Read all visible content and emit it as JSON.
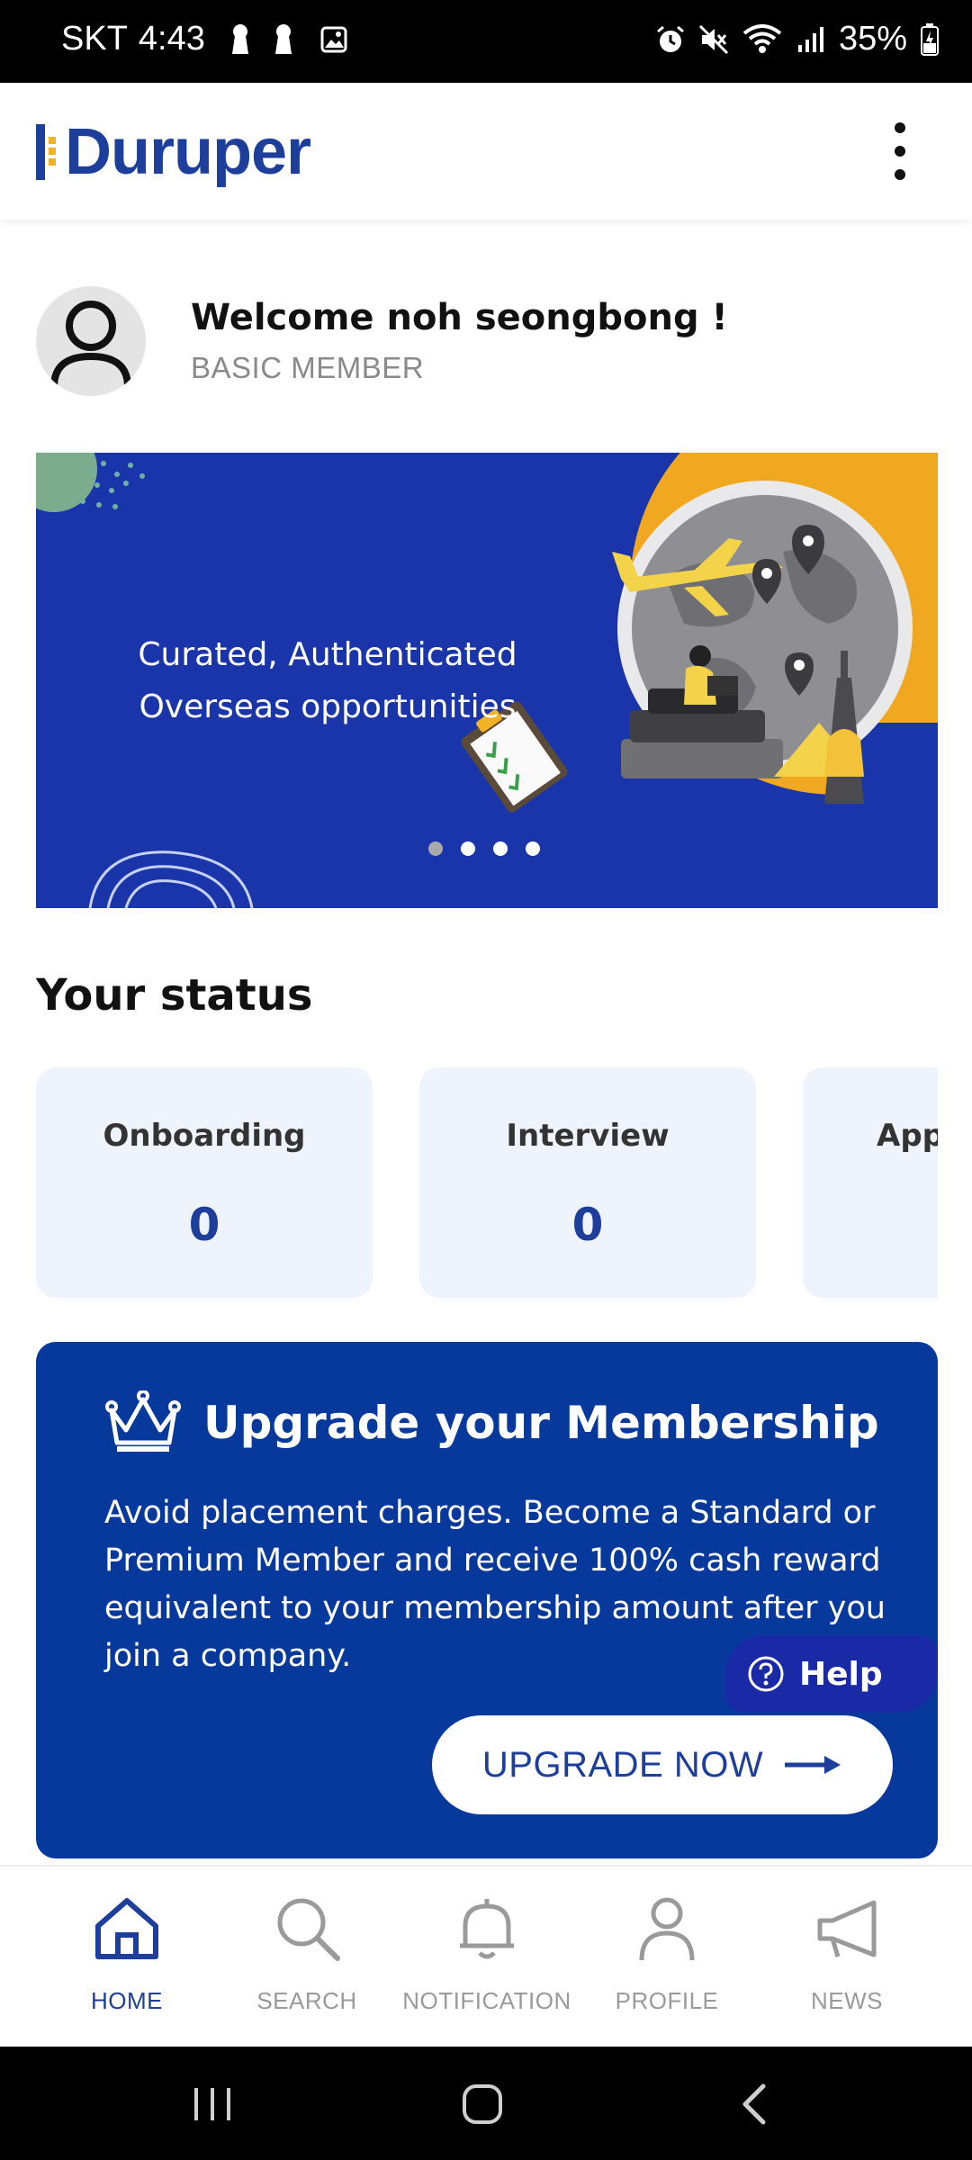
{
  "status_bar": {
    "carrier": "SKT",
    "time": "4:43",
    "battery": "35%",
    "left_icons": [
      "keyhole-icon",
      "keyhole-icon",
      "image-icon"
    ],
    "right_icons": [
      "alarm-icon",
      "mute-icon",
      "wifi-icon",
      "signal-icon",
      "battery-icon"
    ]
  },
  "header": {
    "logo_text": "Duruper",
    "more_icon": "more-vert-icon",
    "brand_color": "#1d3f9b",
    "accent_color": "#f0b323"
  },
  "welcome": {
    "title": "Welcome noh seongbong !",
    "membership": "BASIC MEMBER",
    "avatar_icon": "user-avatar-icon"
  },
  "banner": {
    "line1": "Curated, Authenticated",
    "line2": "Overseas opportunities",
    "slide_count": 4,
    "active_slide": 1,
    "background_color": "#1a35a9"
  },
  "status_section": {
    "title": "Your status",
    "cards": [
      {
        "label": "Onboarding",
        "value": "0"
      },
      {
        "label": "Interview",
        "value": "0"
      },
      {
        "label": "App",
        "value": ""
      }
    ]
  },
  "upgrade": {
    "title": "Upgrade your Membership",
    "crown_icon": "crown-icon",
    "text": "Avoid placement charges. Become a Standard or Premium Member and receive 100% cash reward equivalent to your membership amount after you join a company.",
    "button_label": "UPGRADE NOW",
    "background_color": "#06399b"
  },
  "help": {
    "label": "Help",
    "icon": "help-circle-icon"
  },
  "bottom_nav": {
    "items": [
      {
        "label": "HOME",
        "icon": "home-icon",
        "active": true
      },
      {
        "label": "SEARCH",
        "icon": "search-icon",
        "active": false
      },
      {
        "label": "NOTIFICATION",
        "icon": "bell-icon",
        "active": false
      },
      {
        "label": "PROFILE",
        "icon": "profile-icon",
        "active": false
      },
      {
        "label": "NEWS",
        "icon": "megaphone-icon",
        "active": false
      }
    ]
  },
  "system_nav": {
    "buttons": [
      "recents-icon",
      "home-circle-icon",
      "back-icon"
    ]
  }
}
